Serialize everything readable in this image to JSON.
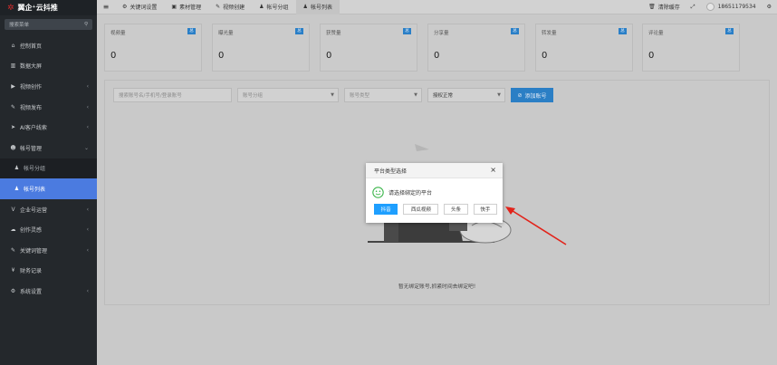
{
  "app": {
    "logo_text": "翼企⁺云抖推"
  },
  "sidebar": {
    "search_placeholder": "搜索菜单",
    "items": [
      {
        "label": "控制首页",
        "icon": "home-icon"
      },
      {
        "label": "数据大屏",
        "icon": "chart-icon"
      },
      {
        "label": "视频创作",
        "icon": "video-icon"
      },
      {
        "label": "视频发布",
        "icon": "send-icon"
      },
      {
        "label": "AI客户线索",
        "icon": "navigation-icon"
      },
      {
        "label": "帐号管理",
        "icon": "user-icon"
      },
      {
        "label": "帐号分组",
        "icon": "user-icon"
      },
      {
        "label": "帐号列表",
        "icon": "user-icon"
      },
      {
        "label": "企业号运营",
        "icon": "v-icon"
      },
      {
        "label": "创作灵感",
        "icon": "cloud-icon"
      },
      {
        "label": "关键词管理",
        "icon": "tag-icon"
      },
      {
        "label": "财务记录",
        "icon": "yen-icon"
      },
      {
        "label": "系统设置",
        "icon": "gear-icon"
      }
    ]
  },
  "topbar": {
    "tabs": [
      {
        "label": "关键词设置",
        "icon": "gear-icon"
      },
      {
        "label": "素材管理",
        "icon": "image-icon"
      },
      {
        "label": "视频创建",
        "icon": "edit-icon"
      },
      {
        "label": "帐号分组",
        "icon": "user-icon"
      },
      {
        "label": "帐号列表",
        "icon": "user-icon"
      }
    ],
    "clear_cache": "清除缓存",
    "username": "18651179534"
  },
  "stats": [
    {
      "label": "视频量",
      "badge": "总",
      "value": "0"
    },
    {
      "label": "曝光量",
      "badge": "总",
      "value": "0"
    },
    {
      "label": "获赞量",
      "badge": "总",
      "value": "0"
    },
    {
      "label": "分享量",
      "badge": "总",
      "value": "0"
    },
    {
      "label": "转发量",
      "badge": "总",
      "value": "0"
    },
    {
      "label": "评论量",
      "badge": "总",
      "value": "0"
    }
  ],
  "filters": {
    "search_placeholder": "搜索账号名/手机号/登录账号",
    "group_placeholder": "账号分组",
    "type_placeholder": "账号类型",
    "auth_status": "授权正常",
    "add_button": "添加账号"
  },
  "empty_state": "暂无绑定账号,抓紧时间去绑定吧!",
  "modal": {
    "title": "平台类型选择",
    "message": "请选择绑定的平台",
    "buttons": [
      "抖音",
      "西瓜视频",
      "头条",
      "快手"
    ]
  },
  "colors": {
    "sidebar_bg": "#24282c",
    "active_blue": "#4b7be0",
    "primary": "#1e9fff",
    "badge": "#2a7fc7",
    "smile_green": "#3ab54a",
    "arrow_red": "#e2231a"
  }
}
